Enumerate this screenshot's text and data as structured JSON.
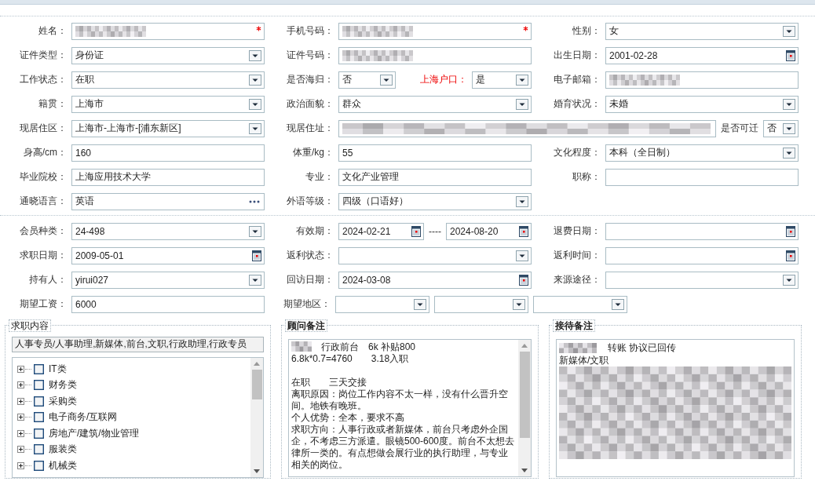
{
  "sections": [
    {
      "rows": [
        {
          "cells": [
            {
              "label": "姓名：",
              "fields": [
                {
                  "kind": "text",
                  "redacted": true,
                  "required": true
                }
              ]
            },
            {
              "label": "手机号码：",
              "fields": [
                {
                  "kind": "text",
                  "redacted": true,
                  "required": true
                }
              ]
            },
            {
              "label": "性别：",
              "fields": [
                {
                  "kind": "select",
                  "value": "女"
                }
              ]
            }
          ]
        },
        {
          "cells": [
            {
              "label": "证件类型：",
              "fields": [
                {
                  "kind": "select",
                  "value": "身份证"
                }
              ]
            },
            {
              "label": "证件号码：",
              "fields": [
                {
                  "kind": "text",
                  "redacted": true
                }
              ]
            },
            {
              "label": "出生日期：",
              "fields": [
                {
                  "kind": "date",
                  "value": "2001-02-28"
                }
              ]
            }
          ]
        },
        {
          "cells": [
            {
              "label": "工作状态：",
              "fields": [
                {
                  "kind": "select",
                  "value": "在职"
                }
              ]
            },
            {
              "label": "是否海归：",
              "kind": "split",
              "fields": [
                {
                  "kind": "select",
                  "value": "否"
                },
                {
                  "kind": "label",
                  "text": "上海户口：",
                  "emphasis": true
                },
                {
                  "kind": "select",
                  "value": "是"
                }
              ]
            },
            {
              "label": "电子邮箱：",
              "fields": [
                {
                  "kind": "text",
                  "redacted": true
                }
              ]
            }
          ]
        },
        {
          "cells": [
            {
              "label": "籍贯：",
              "fields": [
                {
                  "kind": "select",
                  "value": "上海市"
                }
              ]
            },
            {
              "label": "政治面貌：",
              "fields": [
                {
                  "kind": "select",
                  "value": "群众"
                }
              ]
            },
            {
              "label": "婚育状况：",
              "fields": [
                {
                  "kind": "select",
                  "value": "未婚"
                }
              ]
            }
          ]
        },
        {
          "cells": [
            {
              "label": "现居住区：",
              "fields": [
                {
                  "kind": "select",
                  "value": "上海市-上海市-[浦东新区]"
                }
              ]
            },
            {
              "label": "现居住址：",
              "kind": "wide",
              "fields": [
                {
                  "kind": "text",
                  "redacted": true
                },
                {
                  "kind": "label",
                  "text": "是否可迁",
                  "emphasis": false
                },
                {
                  "kind": "select",
                  "value": "否"
                }
              ]
            }
          ]
        },
        {
          "cells": [
            {
              "label": "身高/cm：",
              "fields": [
                {
                  "kind": "text",
                  "value": "160"
                }
              ]
            },
            {
              "label": "体重/kg：",
              "fields": [
                {
                  "kind": "text",
                  "value": "55"
                }
              ]
            },
            {
              "label": "文化程度：",
              "fields": [
                {
                  "kind": "select",
                  "value": "本科（全日制）"
                }
              ]
            }
          ]
        },
        {
          "cells": [
            {
              "label": "毕业院校：",
              "fields": [
                {
                  "kind": "text",
                  "value": "上海应用技术大学"
                }
              ]
            },
            {
              "label": "专业：",
              "fields": [
                {
                  "kind": "text",
                  "value": "文化产业管理"
                }
              ]
            },
            {
              "label": "职称：",
              "fields": [
                {
                  "kind": "text"
                }
              ]
            }
          ]
        },
        {
          "cells": [
            {
              "label": "通晓语言：",
              "fields": [
                {
                  "kind": "lookup",
                  "value": "英语"
                }
              ]
            },
            {
              "label": "外语等级：",
              "fields": [
                {
                  "kind": "select",
                  "value": "四级（口语好）"
                }
              ]
            }
          ]
        }
      ]
    },
    {
      "rows": [
        {
          "cells": [
            {
              "label": "会员种类：",
              "fields": [
                {
                  "kind": "select",
                  "value": "24-498"
                }
              ]
            },
            {
              "label": "有效期：",
              "kind": "range",
              "fields": [
                {
                  "kind": "date",
                  "value": "2024-02-21"
                },
                {
                  "kind": "label",
                  "text": "----",
                  "emphasis": false
                },
                {
                  "kind": "date",
                  "value": "2024-08-20"
                }
              ]
            },
            {
              "label": "退费日期：",
              "fields": [
                {
                  "kind": "date"
                }
              ]
            }
          ]
        },
        {
          "cells": [
            {
              "label": "求职日期：",
              "fields": [
                {
                  "kind": "date",
                  "value": "2009-05-01"
                }
              ]
            },
            {
              "label": "返利状态：",
              "fields": [
                {
                  "kind": "select"
                }
              ]
            },
            {
              "label": "返利时间：",
              "fields": [
                {
                  "kind": "date"
                }
              ]
            }
          ]
        },
        {
          "cells": [
            {
              "label": "持有人：",
              "fields": [
                {
                  "kind": "select",
                  "value": "yirui027"
                }
              ]
            },
            {
              "label": "回访日期：",
              "fields": [
                {
                  "kind": "date",
                  "value": "2024-03-08"
                }
              ]
            },
            {
              "label": "来源途径：",
              "fields": [
                {
                  "kind": "select"
                }
              ]
            }
          ]
        },
        {
          "cells": [
            {
              "label": "期望工资：",
              "fields": [
                {
                  "kind": "text",
                  "value": "6000"
                }
              ]
            },
            {
              "label": "期望地区：",
              "kind": "multi",
              "fields": [
                {
                  "kind": "select"
                },
                {
                  "kind": "select"
                },
                {
                  "kind": "select"
                }
              ]
            }
          ]
        }
      ]
    }
  ],
  "job_content": {
    "title": "求职内容",
    "selected_text": "人事专员/人事助理,新媒体,前台,文职,行政助理,行政专员",
    "categories": [
      {
        "label": "IT类",
        "checked": false,
        "expanded": false
      },
      {
        "label": "财务类",
        "checked": false,
        "expanded": false
      },
      {
        "label": "采购类",
        "checked": false,
        "expanded": false
      },
      {
        "label": "电子商务/互联网",
        "checked": false,
        "expanded": false
      },
      {
        "label": "房地产/建筑/物业管理",
        "checked": false,
        "expanded": false
      },
      {
        "label": "服装类",
        "checked": false,
        "expanded": false
      },
      {
        "label": "机械类",
        "checked": false,
        "expanded": false
      }
    ]
  },
  "advisor_notes": {
    "title": "顾问备注",
    "redacted_lead": true,
    "paragraphs": [
      {
        "text": "行政前台　6k 补贴800",
        "space_before": false
      },
      {
        "text": "6.8k*0.7=4760　　3.18入职",
        "space_before": false
      },
      {
        "text": "在职　　三天交接",
        "space_before": true
      },
      {
        "text": "离职原因：岗位工作内容不太一样，没有什么晋升空间。地铁有晚班。",
        "space_before": false
      },
      {
        "text": "个人优势：全本，要求不高",
        "space_before": false
      },
      {
        "text": "求职方向：人事行政或者新媒体，前台只考虑外企国企，不考虑三方派遣。眼镜500-600度。前台不太想去律所一类的。有点想做会展行业的执行助理，与专业相关的岗位。",
        "space_before": false
      }
    ]
  },
  "reception_notes": {
    "title": "接待备注",
    "lines": [
      {
        "text": "转账  协议已回传",
        "redacted": true
      },
      {
        "text": "新媒体/文职",
        "redacted": false
      }
    ],
    "redacted_body": true
  }
}
